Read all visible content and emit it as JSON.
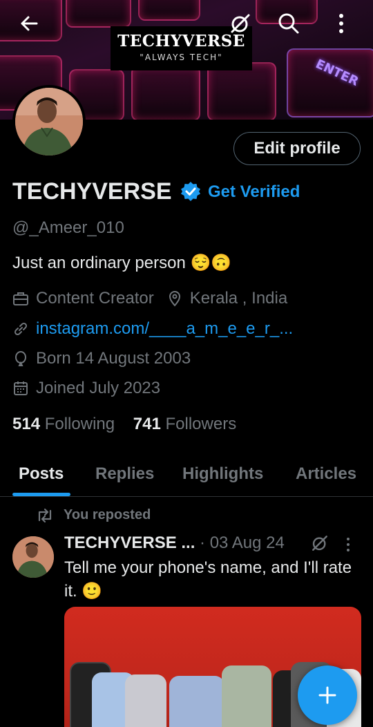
{
  "banner": {
    "brand_title": "TECHYVERSE",
    "brand_subtitle": "\"ALWAYS TECH\"",
    "key_label": "ENTER"
  },
  "header": {
    "back_icon": "arrow-left-icon",
    "grok_icon": "grok-icon",
    "search_icon": "search-icon",
    "more_icon": "more-vertical-icon"
  },
  "profile": {
    "edit_label": "Edit profile",
    "name": "TECHYVERSE",
    "get_verified": "Get Verified",
    "handle": "@_Ameer_010",
    "bio": "Just an ordinary person 😌🙃",
    "category": "Content Creator",
    "location": "Kerala , India",
    "link": "instagram.com/____a_m_e_e_r_...",
    "born": "Born 14 August 2003",
    "joined": "Joined July 2023",
    "following_count": "514",
    "following_label": "Following",
    "followers_count": "741",
    "followers_label": "Followers"
  },
  "tabs": [
    {
      "label": "Posts",
      "active": true
    },
    {
      "label": "Replies",
      "active": false
    },
    {
      "label": "Highlights",
      "active": false
    },
    {
      "label": "Articles",
      "active": false
    }
  ],
  "post": {
    "repost_label": "You reposted",
    "author": "TECHYVERSE ...",
    "date": "· 03 Aug 24",
    "text": "Tell me your phone's name, and I'll rate it. 🙂"
  },
  "colors": {
    "accent": "#1d9bf0",
    "background": "#000000",
    "text_primary": "#e7e9ea",
    "text_secondary": "#71767b"
  }
}
